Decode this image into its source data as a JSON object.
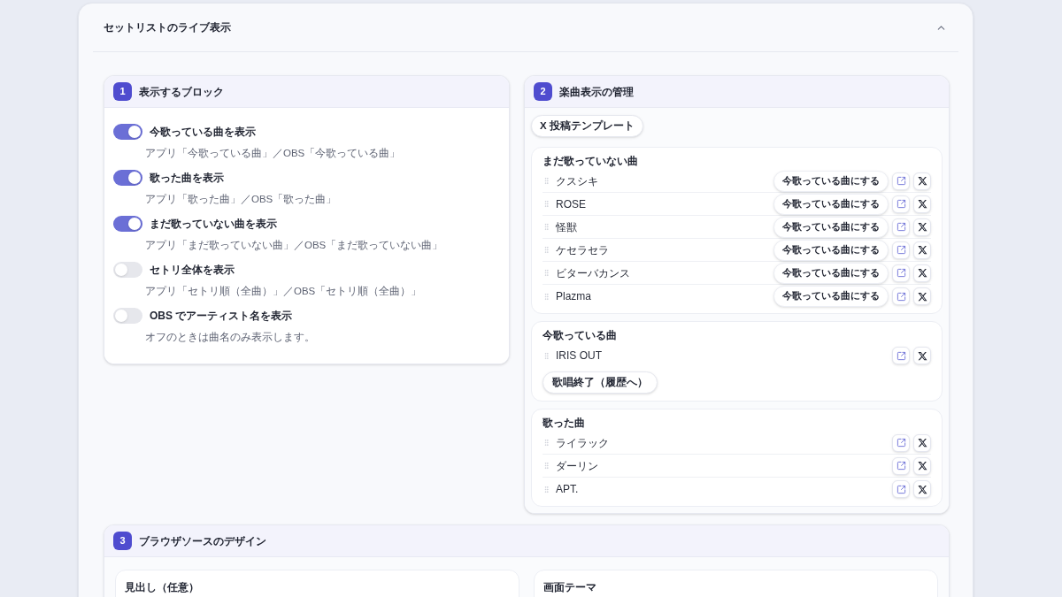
{
  "panel": {
    "title": "セットリストのライブ表示",
    "expanded": true
  },
  "sections": [
    {
      "kind": "toggles",
      "number": "1",
      "title": "表示するブロック",
      "toggles": [
        {
          "label": "今歌っている曲を表示",
          "description": "アプリ「今歌っている曲」／OBS「今歌っている曲」",
          "on": true
        },
        {
          "label": "歌った曲を表示",
          "description": "アプリ「歌った曲」／OBS「歌った曲」",
          "on": true
        },
        {
          "label": "まだ歌っていない曲を表示",
          "description": "アプリ「まだ歌っていない曲」／OBS「まだ歌っていない曲」",
          "on": true
        },
        {
          "label": "セトリ全体を表示",
          "description": "アプリ「セトリ順（全曲）」／OBS「セトリ順（全曲）」",
          "on": false
        },
        {
          "label": "OBS でアーティスト名を表示",
          "description": "オフのときは曲名のみ表示します。",
          "on": false
        }
      ]
    },
    {
      "kind": "songs",
      "number": "2",
      "title": "楽曲表示の管理",
      "template_button": "X 投稿テンプレート",
      "groups": [
        {
          "title": "まだ歌っていない曲",
          "songs": [
            {
              "name": "クスシキ",
              "action": "今歌っている曲にする"
            },
            {
              "name": "ROSE",
              "action": "今歌っている曲にする"
            },
            {
              "name": "怪獣",
              "action": "今歌っている曲にする"
            },
            {
              "name": "ケセラセラ",
              "action": "今歌っている曲にする"
            },
            {
              "name": "ビターバカンス",
              "action": "今歌っている曲にする"
            },
            {
              "name": "Plazma",
              "action": "今歌っている曲にする"
            }
          ]
        },
        {
          "title": "今歌っている曲",
          "songs": [
            {
              "name": "IRIS OUT"
            }
          ],
          "finish_button": "歌唱終了（履歴へ）"
        },
        {
          "title": "歌った曲",
          "songs": [
            {
              "name": "ライラック"
            },
            {
              "name": "ダーリン"
            },
            {
              "name": "APT."
            }
          ]
        }
      ]
    },
    {
      "kind": "design",
      "number": "3",
      "title": "ブラウザソースのデザイン",
      "fields": [
        {
          "label": "見出し（任意）"
        },
        {
          "label": "画面テーマ"
        }
      ]
    }
  ]
}
